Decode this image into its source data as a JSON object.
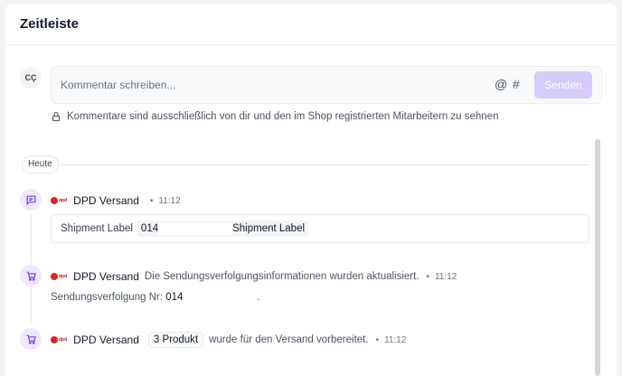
{
  "header": {
    "title": "Zeitleiste"
  },
  "composer": {
    "avatar_initials": "CÇ",
    "placeholder": "Kommentar schreiben...",
    "mention_symbol": "@",
    "hashtag_symbol": "#",
    "send_label": "Senden",
    "send_color": "#d6ccfb",
    "privacy_hint": "Kommentare sind ausschließlich von dir und den im Shop registrierten Mitarbeitern zu sehnen",
    "privacy_icon": "lock-icon"
  },
  "day_divider": {
    "label": "Heute"
  },
  "events": [
    {
      "icon": "comment-icon",
      "carrier_logo_text": "dpd",
      "actor": "DPD Versand",
      "message": "",
      "time": "11:12",
      "panel_label": "Shipment Label",
      "panel_value": "014",
      "panel_tag": "Shipment Label"
    },
    {
      "icon": "cart-icon",
      "carrier_logo_text": "dpd",
      "actor": "DPD Versand",
      "message": "Die Sendungsverfolgungsinformationen wurden aktualisiert.",
      "time": "11:12",
      "detail_label": "Sendungsverfolgung Nr:",
      "detail_value": "014",
      "detail_suffix": "."
    },
    {
      "icon": "cart-icon",
      "carrier_logo_text": "dpd",
      "actor": "DPD Versand",
      "product_badge": "3 Produkt",
      "message": "wurde für den Versand vorbereitet.",
      "time": "11:12"
    }
  ],
  "accent_color": "#7c3aed"
}
